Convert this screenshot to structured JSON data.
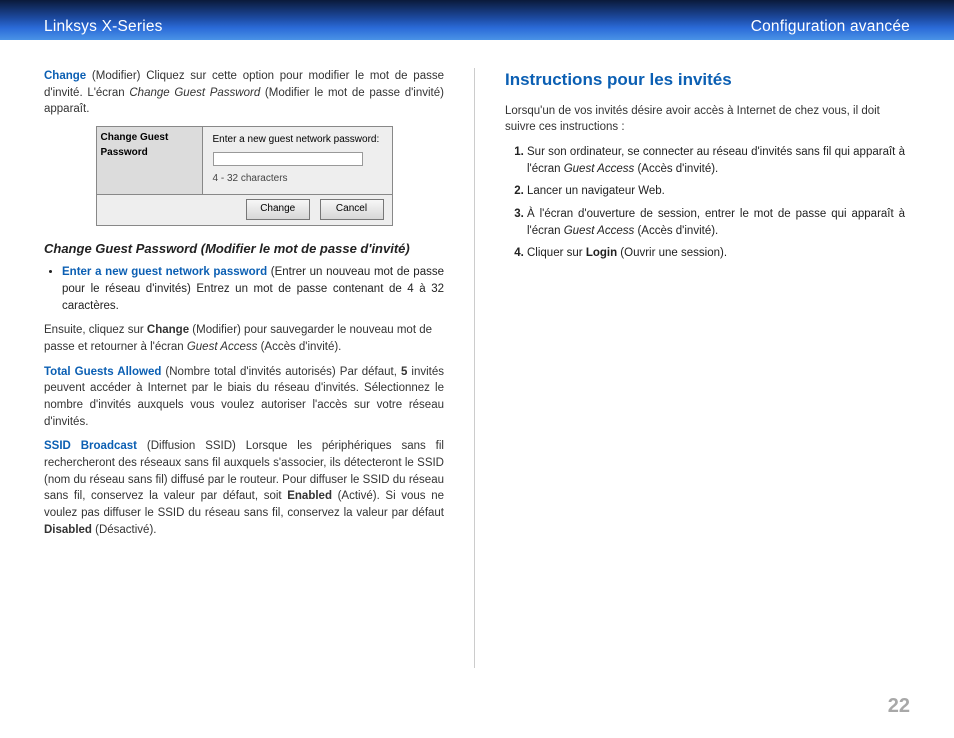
{
  "header": {
    "left": "Linksys X-Series",
    "right": "Configuration avancée"
  },
  "left": {
    "p1_label": "Change",
    "p1_rest": " (Modifier)  Cliquez sur cette option pour modifier le mot de passe d'invité. L'écran ",
    "p1_em": "Change Guest Password",
    "p1_tail": " (Modifier le mot de passe d'invité) apparaît.",
    "dlg": {
      "side_label": "Change Guest Password",
      "prompt": "Enter a new guest network password:",
      "hint": "4 - 32 characters",
      "btn_change": "Change",
      "btn_cancel": "Cancel"
    },
    "sub_heading": "Change Guest Password (Modifier le mot de passe d'invité)",
    "bullet_label": "Enter a new guest network password",
    "bullet_rest": " (Entrer un nouveau mot de passe pour le réseau d'invités)  Entrez un mot de passe contenant de 4 à 32 caractères.",
    "indent_pre": "Ensuite, cliquez sur ",
    "indent_strong": "Change",
    "indent_mid": " (Modifier) pour sauvegarder le nouveau mot de passe et retourner à l'écran ",
    "indent_em": "Guest Access",
    "indent_tail": " (Accès d'invité).",
    "p2_label": "Total Guests Allowed",
    "p2_a": " (Nombre total d'invités autorisés)  Par défaut, ",
    "p2_strong": "5",
    "p2_b": " invités peuvent accéder à Internet par le biais du réseau d'invités. Sélectionnez le nombre d'invités auxquels vous voulez autoriser l'accès sur votre réseau d'invités.",
    "p3_label": "SSID Broadcast",
    "p3_a": " (Diffusion SSID)  Lorsque les périphériques sans fil rechercheront des réseaux sans fil auxquels s'associer, ils détecteront le SSID (nom du réseau sans fil) diffusé par le routeur. Pour diffuser le SSID du réseau sans fil, conservez la valeur par défaut, soit ",
    "p3_s1": "Enabled",
    "p3_b": " (Activé). Si vous ne voulez pas diffuser le SSID du réseau sans fil, conservez la valeur par défaut ",
    "p3_s2": "Disabled",
    "p3_c": " (Désactivé)."
  },
  "right": {
    "heading": "Instructions pour les invités",
    "intro": "Lorsqu'un de vos invités désire avoir accès à Internet de chez vous, il doit suivre ces instructions :",
    "li1_a": "Sur son ordinateur, se connecter au réseau d'invités sans fil qui apparaît à l'écran ",
    "li1_em": "Guest Access",
    "li1_b": " (Accès d'invité).",
    "li2": "Lancer un navigateur Web.",
    "li3_a": "À l'écran d'ouverture de session, entrer le mot de passe qui apparaît à l'écran ",
    "li3_em": "Guest Access",
    "li3_b": " (Accès d'invité).",
    "li4_a": "Cliquer sur ",
    "li4_strong": "Login",
    "li4_b": " (Ouvrir une session)."
  },
  "page_number": "22"
}
